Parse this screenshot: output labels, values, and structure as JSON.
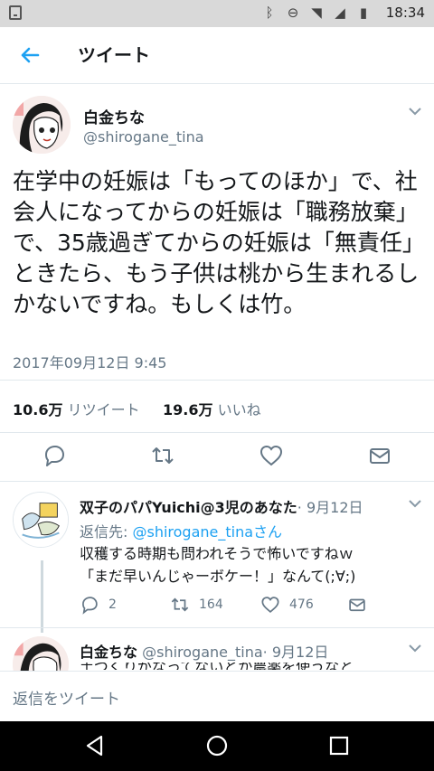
{
  "status_bar": {
    "time": "18:34"
  },
  "app_bar": {
    "title": "ツイート"
  },
  "tweet": {
    "display_name": "白金ちな",
    "handle": "@shirogane_tina",
    "text": "在学中の妊娠は「もってのほか」で、社会人になってからの妊娠は「職務放棄」で、35歳過ぎてからの妊娠は「無責任」ときたら、もう子供は桃から生まれるしかないですね。もしくは竹。",
    "timestamp": "2017年09月12日 9:45",
    "retweet_count": "10.6万",
    "retweet_label": "リツイート",
    "like_count": "19.6万",
    "like_label": "いいね"
  },
  "reply": {
    "display_name": "双子のパパYuichi@3児のあなた",
    "date": "· 9月12日",
    "reply_to_prefix": "返信先: ",
    "reply_to_handle": "@shirogane_tinaさん",
    "text_line1": "収穫する時期も問われそうで怖いですねｗ",
    "text_line2": "「まだ早いんじゃーボケー！」なんて(;∀;)",
    "reply_count": "2",
    "retweet_count": "164",
    "like_count": "476"
  },
  "next_reply": {
    "display_name": "白金ちな",
    "handle": "@shirogane_tina",
    "date": "· 9月12日",
    "text_partial": "土づくりがなってないとか農薬を使うなと"
  },
  "composer": {
    "placeholder": "返信をツイート"
  },
  "colors": {
    "accent": "#1da1f2",
    "muted": "#657786",
    "text": "#14171a"
  }
}
